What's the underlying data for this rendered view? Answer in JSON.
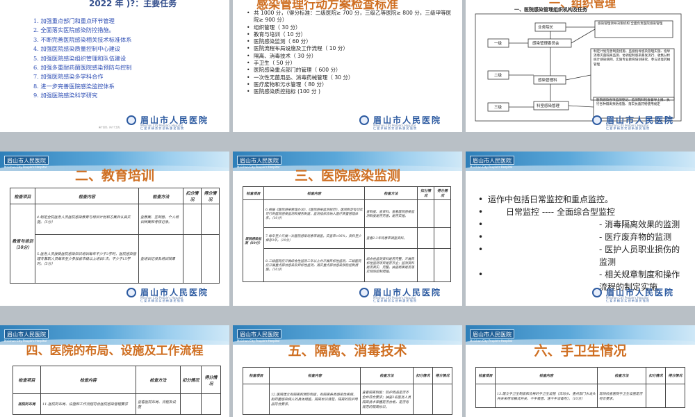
{
  "slides": {
    "s1": {
      "heading": "2022 年 )?：主要任务",
      "items": [
        "1. 加强重点部门和重点环节管理",
        "2. 全面落实医院感染防控措施。",
        "3. 不断完善医院感染相关技术标准体系",
        "4. 加强医院感染质量控制中心建设",
        "5. 加强医院感染组织管理和队伍建设",
        "6. 加强多重耐药菌医院感染预防与控制",
        "7. 加强医院感染多学科合作",
        "8. 进一步完善医院感染监控体系",
        "9. 加强医院感染科学研究"
      ]
    },
    "s2": {
      "heading": "感染管理行动方案检查标准",
      "items": [
        "共 1000 分，（得分标准：二级医院≥ 700 分，三级乙等医院≥ 800 分，三级甲等医院≥ 900 分）",
        "组织管理（ 30 分）",
        "教育与培训（ 10 分）",
        "医院感染监测（ 60 分）",
        "医院流程布局设施及工作流程（ 10 分）",
        "隔离、消毒技术（ 30 分）",
        "手卫生（ 50 分）",
        "医院感染重点部门的管理（ 600 分）",
        "一次性无菌用品、消毒药械管理（ 30 分）",
        "医疗废物和污水管理（ 80 分）",
        "医院感染质控指标 (100 分 )"
      ]
    },
    "s3": {
      "heading": "一、组织管理",
      "subheading": "一、医院感染管理组织机构及任务",
      "box_top": "业务院长",
      "box_mid": "感染管理委员会",
      "box_office": "感染管理科",
      "box_ward": "科室感染管理",
      "level1": "一级",
      "level2": "二级",
      "level3": "三级",
      "note1": "感染管理领导决策机构 全面负责医院感染管理",
      "note2": "制定计划完善制度措施、监督指导感染管理实施、指导消毒灭菌隔离监测、协调控制感染暴发流行、收集分析统计感染病例、实施专业教育培训研究、参与消毒药械管理",
      "note3": "医院感染各项监测登记、监测院科检查督导上报、执行各种隔离预防措施、落实抗菌药物使用规定"
    },
    "s4": {
      "heading": "二、教育培训",
      "headers": [
        "检查项目",
        "检查内容",
        "检查方法",
        "扣分情况",
        "得分情况"
      ],
      "category": "教育与培训（10分）",
      "rows": [
        [
          "4.制定全院医务人员医院感染教育与培训计划和方案并认真实施。（5分）",
          "查教案、签到册，个人培训档案和考核记录。"
        ],
        [
          "5.医务人员接受医院感染知识培训每年不少于3学时，医院感染管理专兼职人员每年至少参加省市级以上培训1次。不少于15学时。（5分）",
          "查培训记录及培训效果"
        ]
      ]
    },
    "s5": {
      "heading": "三、医院感染监测",
      "headers": [
        "检查项目",
        "检查内容",
        "检查方法",
        "扣分情况",
        "得分情况"
      ],
      "category": "医院感染监测（60分）",
      "rows": [
        [
          "6.根据《医院感染管理办法》、《医院感染监测规范》，医院制定有切实可行的医院感染监测和报告制度，监测指标应纳入医疗质量管理体系。（10分）",
          "查制度、查资料。查看医院感染监测制度是否完善，是否实施。"
        ],
        [
          "7.每年至少开展一次医院感染现患率调查，实查率>96%，资料至少保存3年。（10分）",
          "查看2-3年现患率调查资料。"
        ],
        [
          "8.二级医院应开展综合性监测二年以上并开展目标性监测，三级医院应开展重点部位感染及目标性监测，落实重点部位感染预防控制措施。（10分）",
          "综合性监测资料是否完整，开展目标性监测项目是否齐全；监测资料是否真实、完整，抽查结果是否落实预防控制措施。"
        ]
      ]
    },
    "s6": {
      "items": [
        "运作中包括日常监控和重点监控。",
        "日常监控 ---- 全面综合型监控",
        "- 消毒隔离效果的监测",
        "- 医疗废弃物的监测",
        "- 医护人员职业损伤的监测",
        "- 相关规章制度和操作流程的制定实施"
      ]
    },
    "s7": {
      "heading": "四、医院的布局、设施及工作流程",
      "headers": [
        "检查项目",
        "检查内容",
        "检查方法",
        "扣分情况",
        "得分情况"
      ],
      "category": "医院的布局",
      "row": [
        "11.医院的布局、设施和工作流程符合医院感染管理要求",
        "查看医院布局、流程及设施"
      ]
    },
    "s8": {
      "heading": "五、隔离、消毒技术",
      "headers": [
        "检查项目",
        "检查内容",
        "检查方法",
        "扣分情况",
        "得分情况"
      ],
      "row": [
        "12.医院建立有隔离和预防制度，有隔离各类感染性疾病、耐药菌感染病人的具体措施，隔离标识清楚，隔离的防护用品符合要求。",
        "查看隔离制度：防护用品是否齐全并符合要求；抽查3名医务人员隔离技术掌握是否合格，是否有规范的隔离标识。"
      ]
    },
    "s9": {
      "heading": "六、手卫生情况",
      "headers": [
        "检查项目",
        "检查内容",
        "检查方法",
        "扣分情况",
        "得分情况"
      ],
      "row": [
        "13.建立手卫生制度和合格的手卫生设施（流动水、重点部门水龙头开关采用非触式开关、干手装置、速干手消毒剂）。（10分）",
        "现场检查医院手卫生设施是否符合要求。"
      ]
    }
  },
  "brand": {
    "hospital_name": "眉山市人民医院",
    "hospital_en": "Meishan City People's Hospital",
    "slogan": "仁 爱 求 精  务 实 创 新  惠 民 强 院",
    "banner_text": "眉山市人民医院",
    "banner_en": "Meishan City People's Hospital",
    "page_note": "第十四页，共六十五页。"
  },
  "colors": {
    "title_orange": "#cf6f22",
    "list_blue": "#2f4fb5",
    "brand_blue": "#2c5aa0"
  }
}
